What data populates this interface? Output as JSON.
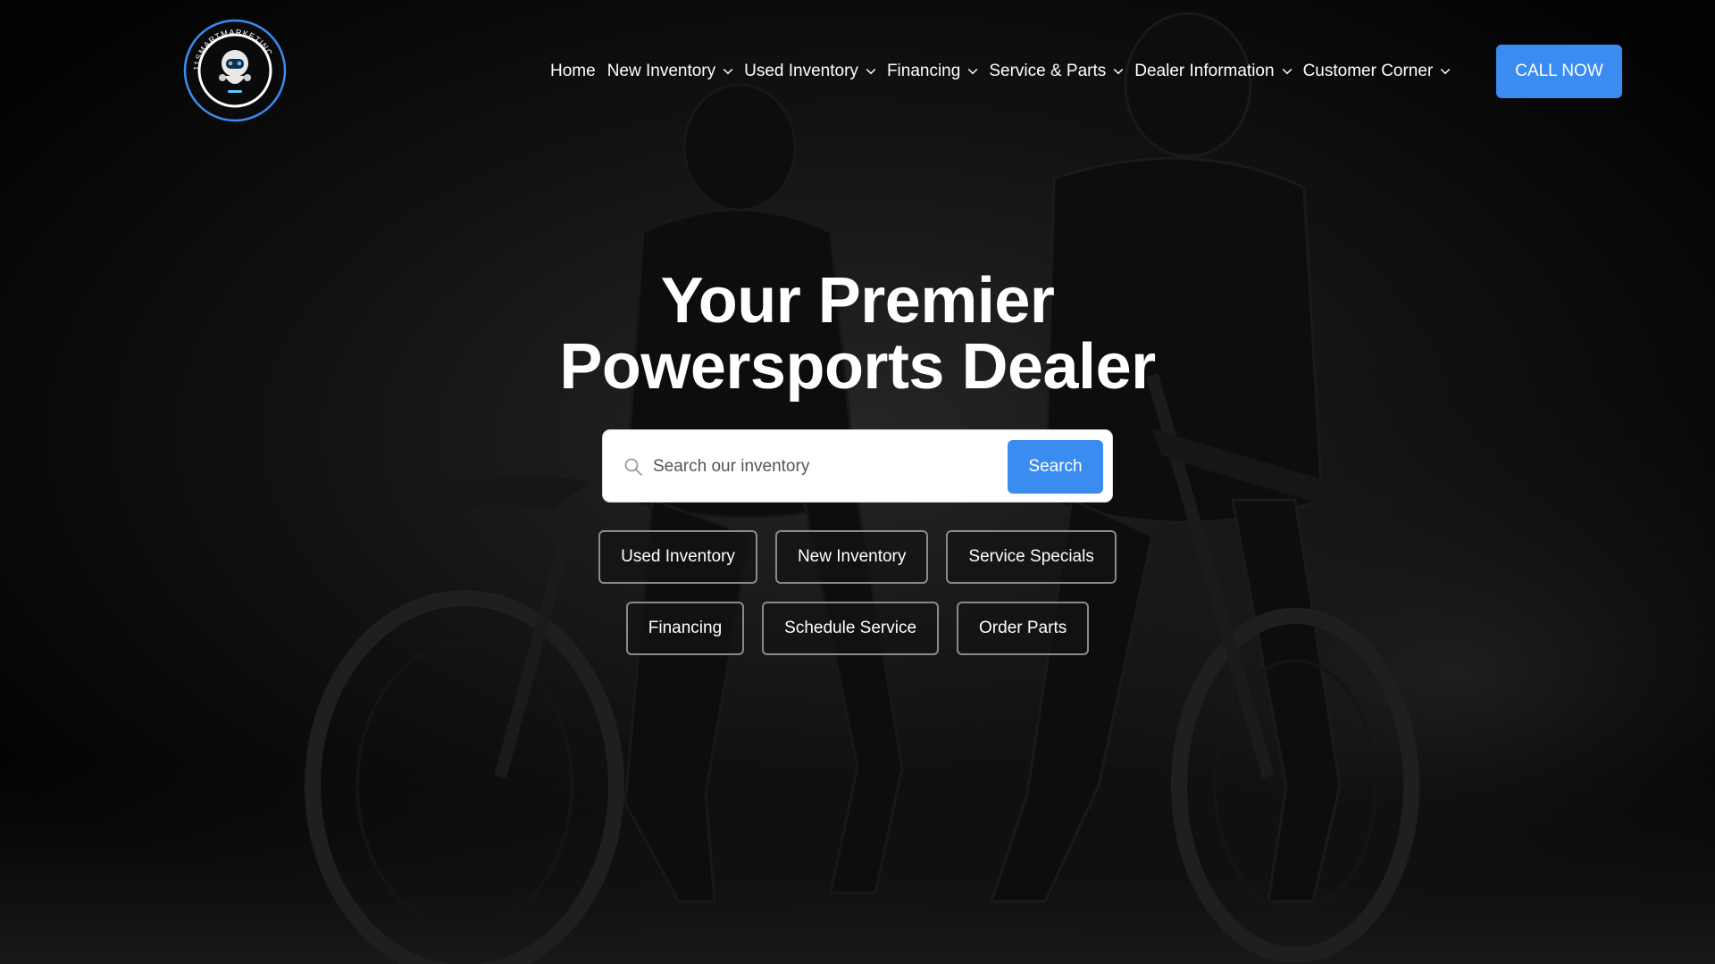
{
  "header": {
    "logo_alt": "11SMARTMARKETINC",
    "logo_text": "11SMARTMARKETINC",
    "nav": [
      {
        "label": "Home",
        "dropdown": false
      },
      {
        "label": "New Inventory",
        "dropdown": true
      },
      {
        "label": "Used Inventory",
        "dropdown": true
      },
      {
        "label": "Financing",
        "dropdown": true
      },
      {
        "label": "Service & Parts",
        "dropdown": true
      },
      {
        "label": "Dealer Information",
        "dropdown": true
      },
      {
        "label": "Customer Corner",
        "dropdown": true
      }
    ],
    "cta_label": "CALL NOW"
  },
  "hero": {
    "title_line1": "Your Premier",
    "title_line2": "Powersports Dealer",
    "search": {
      "placeholder": "Search our inventory",
      "value": "",
      "button_label": "Search"
    },
    "quick_links_row1": [
      "Used Inventory",
      "New Inventory",
      "Service Specials"
    ],
    "quick_links_row2": [
      "Financing",
      "Schedule Service",
      "Order Parts"
    ]
  },
  "colors": {
    "accent": "#3a8cf0",
    "background": "#0b0b0b",
    "text": "#ffffff"
  },
  "icons": {
    "search": "magnifier-icon",
    "dropdown": "chevron-down-icon",
    "logo": "robot-logo-icon"
  }
}
